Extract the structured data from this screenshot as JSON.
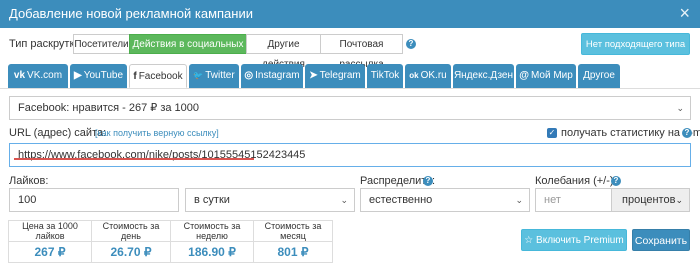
{
  "window": {
    "title": "Добавление новой рекламной кампании",
    "close_symbol": "×"
  },
  "promotion_type": {
    "label": "Тип раскрутки:",
    "options": [
      "Посетители",
      "Действия в социальных сетях",
      "Другие действия",
      "Почтовая рассылка"
    ],
    "selected": "Действия в социальных сетях",
    "no_type_button": "Нет подходящего типа РК?"
  },
  "tabs": [
    {
      "label": "VK.com",
      "icon": "vk-icon",
      "icon_glyph": "vk"
    },
    {
      "label": "YouTube",
      "icon": "youtube-icon",
      "icon_glyph": "▶"
    },
    {
      "label": "Facebook",
      "icon": "facebook-icon",
      "icon_glyph": "f"
    },
    {
      "label": "Twitter",
      "icon": "twitter-icon",
      "icon_glyph": "🐦"
    },
    {
      "label": "Instagram",
      "icon": "instagram-icon",
      "icon_glyph": "◎"
    },
    {
      "label": "Telegram",
      "icon": "telegram-icon",
      "icon_glyph": "➤"
    },
    {
      "label": "TikTok",
      "icon": "",
      "icon_glyph": ""
    },
    {
      "label": "OK.ru",
      "icon": "ok-icon",
      "icon_glyph": "ok"
    },
    {
      "label": "Яндекс.Дзен",
      "icon": "",
      "icon_glyph": ""
    },
    {
      "label": "Мой Мир",
      "icon": "mymir-icon",
      "icon_glyph": "@"
    },
    {
      "label": "Другое",
      "icon": "",
      "icon_glyph": ""
    }
  ],
  "active_tab": "Facebook",
  "action_select": {
    "value": "Facebook: нравится - 267 ₽ за 1000"
  },
  "url": {
    "label": "URL (адрес) сайта:",
    "hint_link": "[как получить верную ссылку]",
    "value": "https://www.facebook.com/nike/posts/10155545152423445",
    "email_stats_label": "получать статистику на e-mail",
    "email_stats_checked": true
  },
  "likes": {
    "label": "Лайков:",
    "value": "100",
    "period": "в сутки"
  },
  "distribute": {
    "label": "Распределить:",
    "value": "естественно"
  },
  "fluctuation": {
    "label": "Колебания (+/-):",
    "placeholder": "нет",
    "unit": "процентов"
  },
  "stats": {
    "headers": [
      "Цена за 1000 лайков",
      "Стоимость за день",
      "Стоимость за неделю",
      "Стоимость за месяц"
    ],
    "values": [
      "267 ₽",
      "26.70 ₽",
      "186.90 ₽",
      "801 ₽"
    ]
  },
  "buttons": {
    "premium": "☆ Включить Premium",
    "save": "Сохранить"
  },
  "colors": {
    "primary": "#3c8dbc",
    "success": "#5cb85c",
    "info": "#5bc0de",
    "underline": "#d9534f"
  },
  "help_glyph": "?",
  "check_glyph": "✓",
  "chevron_glyph": "⌄"
}
